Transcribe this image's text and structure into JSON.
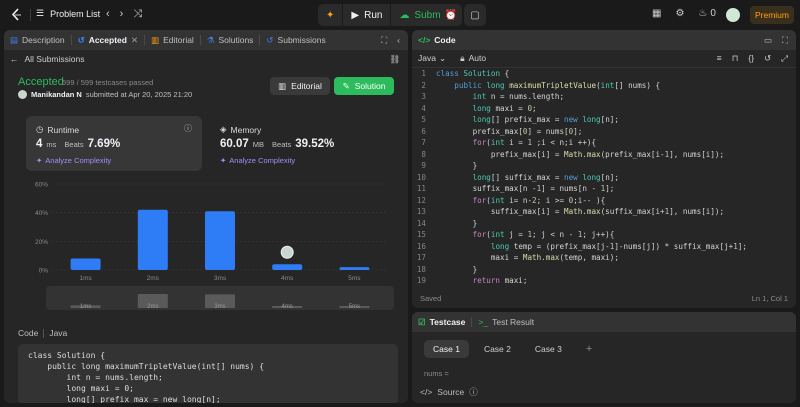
{
  "topbar": {
    "problem_list": "Problem List",
    "run": "Run",
    "submit": "Submit",
    "streak": "0",
    "premium": "Premium"
  },
  "left_tabs": {
    "description": "Description",
    "accepted": "Accepted",
    "editorial": "Editorial",
    "solutions": "Solutions",
    "submissions": "Submissions"
  },
  "submission": {
    "back": "All Submissions",
    "status": "Accepted",
    "passed": "599 / 599 testcases passed",
    "user": "Manikandan N",
    "submitted_text": "submitted at Apr 20, 2025 21:20",
    "editorial_btn": "Editorial",
    "solution_btn": "Solution"
  },
  "runtime": {
    "title": "Runtime",
    "value": "4",
    "unit": "ms",
    "beats_label": "Beats",
    "beats": "7.69%",
    "analyze": "Analyze Complexity"
  },
  "memory": {
    "title": "Memory",
    "value": "60.07",
    "unit": "MB",
    "beats_label": "Beats",
    "beats": "39.52%",
    "analyze": "Analyze Complexity"
  },
  "chart_data": {
    "type": "bar",
    "categories": [
      "1ms",
      "2ms",
      "3ms",
      "4ms",
      "5ms"
    ],
    "values": [
      8,
      42,
      41,
      4,
      2
    ],
    "ylim": [
      0,
      60
    ],
    "yticks": [
      "60%",
      "40%",
      "20%",
      "0%"
    ],
    "highlight_index": 3,
    "color": "#2f7df6"
  },
  "code_section": {
    "label": "Code",
    "lang": "Java",
    "preview": [
      "class Solution {",
      "    public long maximumTripletValue(int[] nums) {",
      "        int n = nums.length;",
      "        long maxi = 0;",
      "        long[] prefix_max = new long[n];"
    ]
  },
  "code_panel": {
    "title": "Code",
    "language": "Java",
    "mode": "Auto",
    "status": "Saved",
    "cursor": "Ln 1, Col 1",
    "lines": [
      "class Solution {",
      "    public long maximumTripletValue(int[] nums) {",
      "        int n = nums.length;",
      "        long maxi = 0;",
      "        long[] prefix_max = new long[n];",
      "        prefix_max[0] = nums[0];",
      "        for(int i = 1 ;i < n;i ++){",
      "            prefix_max[i] = Math.max(prefix_max[i-1], nums[i]);",
      "        }",
      "        long[] suffix_max = new long[n];",
      "        suffix_max[n -1] = nums[n - 1];",
      "        for(int i= n-2; i >= 0;i-- ){",
      "            suffix_max[i] = Math.max(suffix_max[i+1], nums[i]);",
      "        }",
      "        for(int j = 1; j < n - 1; j++){",
      "            long temp = (prefix_max[j-1]-nums[j]) * suffix_max[j+1];",
      "            maxi = Math.max(temp, maxi);",
      "        }",
      "        return maxi;"
    ]
  },
  "testcase": {
    "tab": "Testcase",
    "result_tab": "Test Result",
    "cases": [
      "Case 1",
      "Case 2",
      "Case 3"
    ],
    "nums_label": "nums =",
    "source": "Source"
  }
}
